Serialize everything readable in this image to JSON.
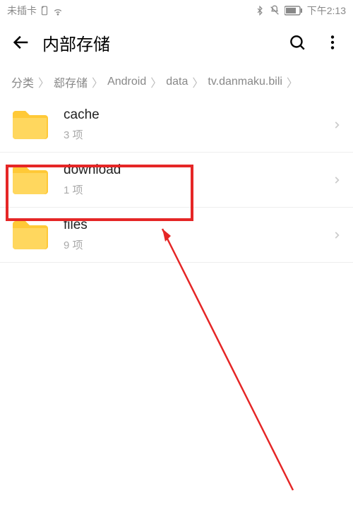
{
  "status": {
    "sim": "未插卡",
    "time": "下午2:13"
  },
  "header": {
    "title": "内部存储"
  },
  "breadcrumb": {
    "root": "分类",
    "items": [
      "郄存储",
      "Android",
      "data",
      "tv.danmaku.bili"
    ]
  },
  "items": [
    {
      "name": "cache",
      "count": "3 项"
    },
    {
      "name": "download",
      "count": "1 项"
    },
    {
      "name": "files",
      "count": "9 项"
    }
  ]
}
